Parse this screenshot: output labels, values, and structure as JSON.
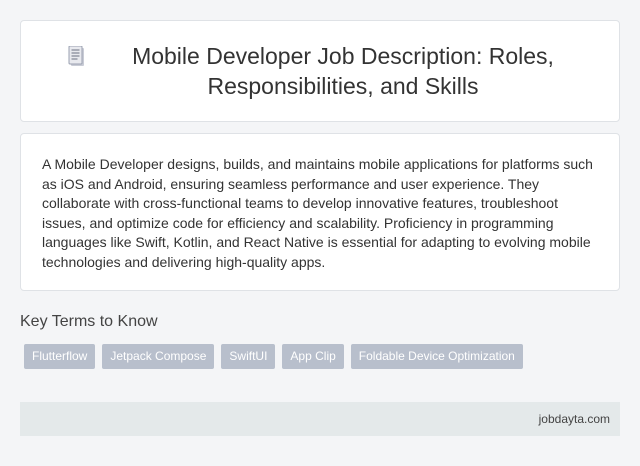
{
  "header": {
    "icon": "document-icon",
    "title": "Mobile Developer Job Description: Roles, Responsibilities, and Skills"
  },
  "description": {
    "text": "A Mobile Developer designs, builds, and maintains mobile applications for platforms such as iOS and Android, ensuring seamless performance and user experience. They collaborate with cross-functional teams to develop innovative features, troubleshoot issues, and optimize code for efficiency and scalability. Proficiency in programming languages like Swift, Kotlin, and React Native is essential for adapting to evolving mobile technologies and delivering high-quality apps."
  },
  "key_terms": {
    "heading": "Key Terms to Know",
    "tags": [
      "Flutterflow",
      "Jetpack Compose",
      "SwiftUI",
      "App Clip",
      "Foldable Device Optimization"
    ]
  },
  "footer": {
    "site": "jobdayta.com"
  },
  "colors": {
    "background": "#f4f5f7",
    "card": "#ffffff",
    "tag": "#b8bfcc",
    "footer": "#e4e9ea"
  }
}
